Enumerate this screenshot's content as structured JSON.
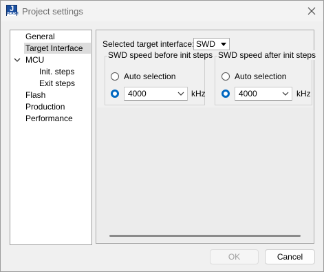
{
  "window": {
    "title": "Project settings",
    "icon": "jflash-app-icon",
    "icon_letters": "J",
    "icon_sub": "FLASH"
  },
  "tree": {
    "items": [
      {
        "label": "General",
        "level": 0,
        "selected": false
      },
      {
        "label": "Target Interface",
        "level": 0,
        "selected": true
      },
      {
        "label": "MCU",
        "level": 0,
        "selected": false,
        "expanded": true
      },
      {
        "label": "Init. steps",
        "level": 1,
        "selected": false
      },
      {
        "label": "Exit steps",
        "level": 1,
        "selected": false
      },
      {
        "label": "Flash",
        "level": 0,
        "selected": false
      },
      {
        "label": "Production",
        "level": 0,
        "selected": false
      },
      {
        "label": "Performance",
        "level": 0,
        "selected": false
      }
    ]
  },
  "target_interface": {
    "label": "Selected target interface:",
    "value": "SWD"
  },
  "speed_before": {
    "title": "SWD speed before init steps",
    "auto_label": "Auto selection",
    "auto_checked": false,
    "speed_value": "4000",
    "unit": "kHz",
    "speed_checked": true
  },
  "speed_after": {
    "title": "SWD speed after init steps",
    "auto_label": "Auto selection",
    "auto_checked": false,
    "speed_value": "4000",
    "unit": "kHz",
    "speed_checked": true
  },
  "buttons": {
    "ok": "OK",
    "ok_enabled": false,
    "cancel": "Cancel"
  },
  "colors": {
    "accent": "#0067c0",
    "selected_bg": "#dcdcdc"
  }
}
